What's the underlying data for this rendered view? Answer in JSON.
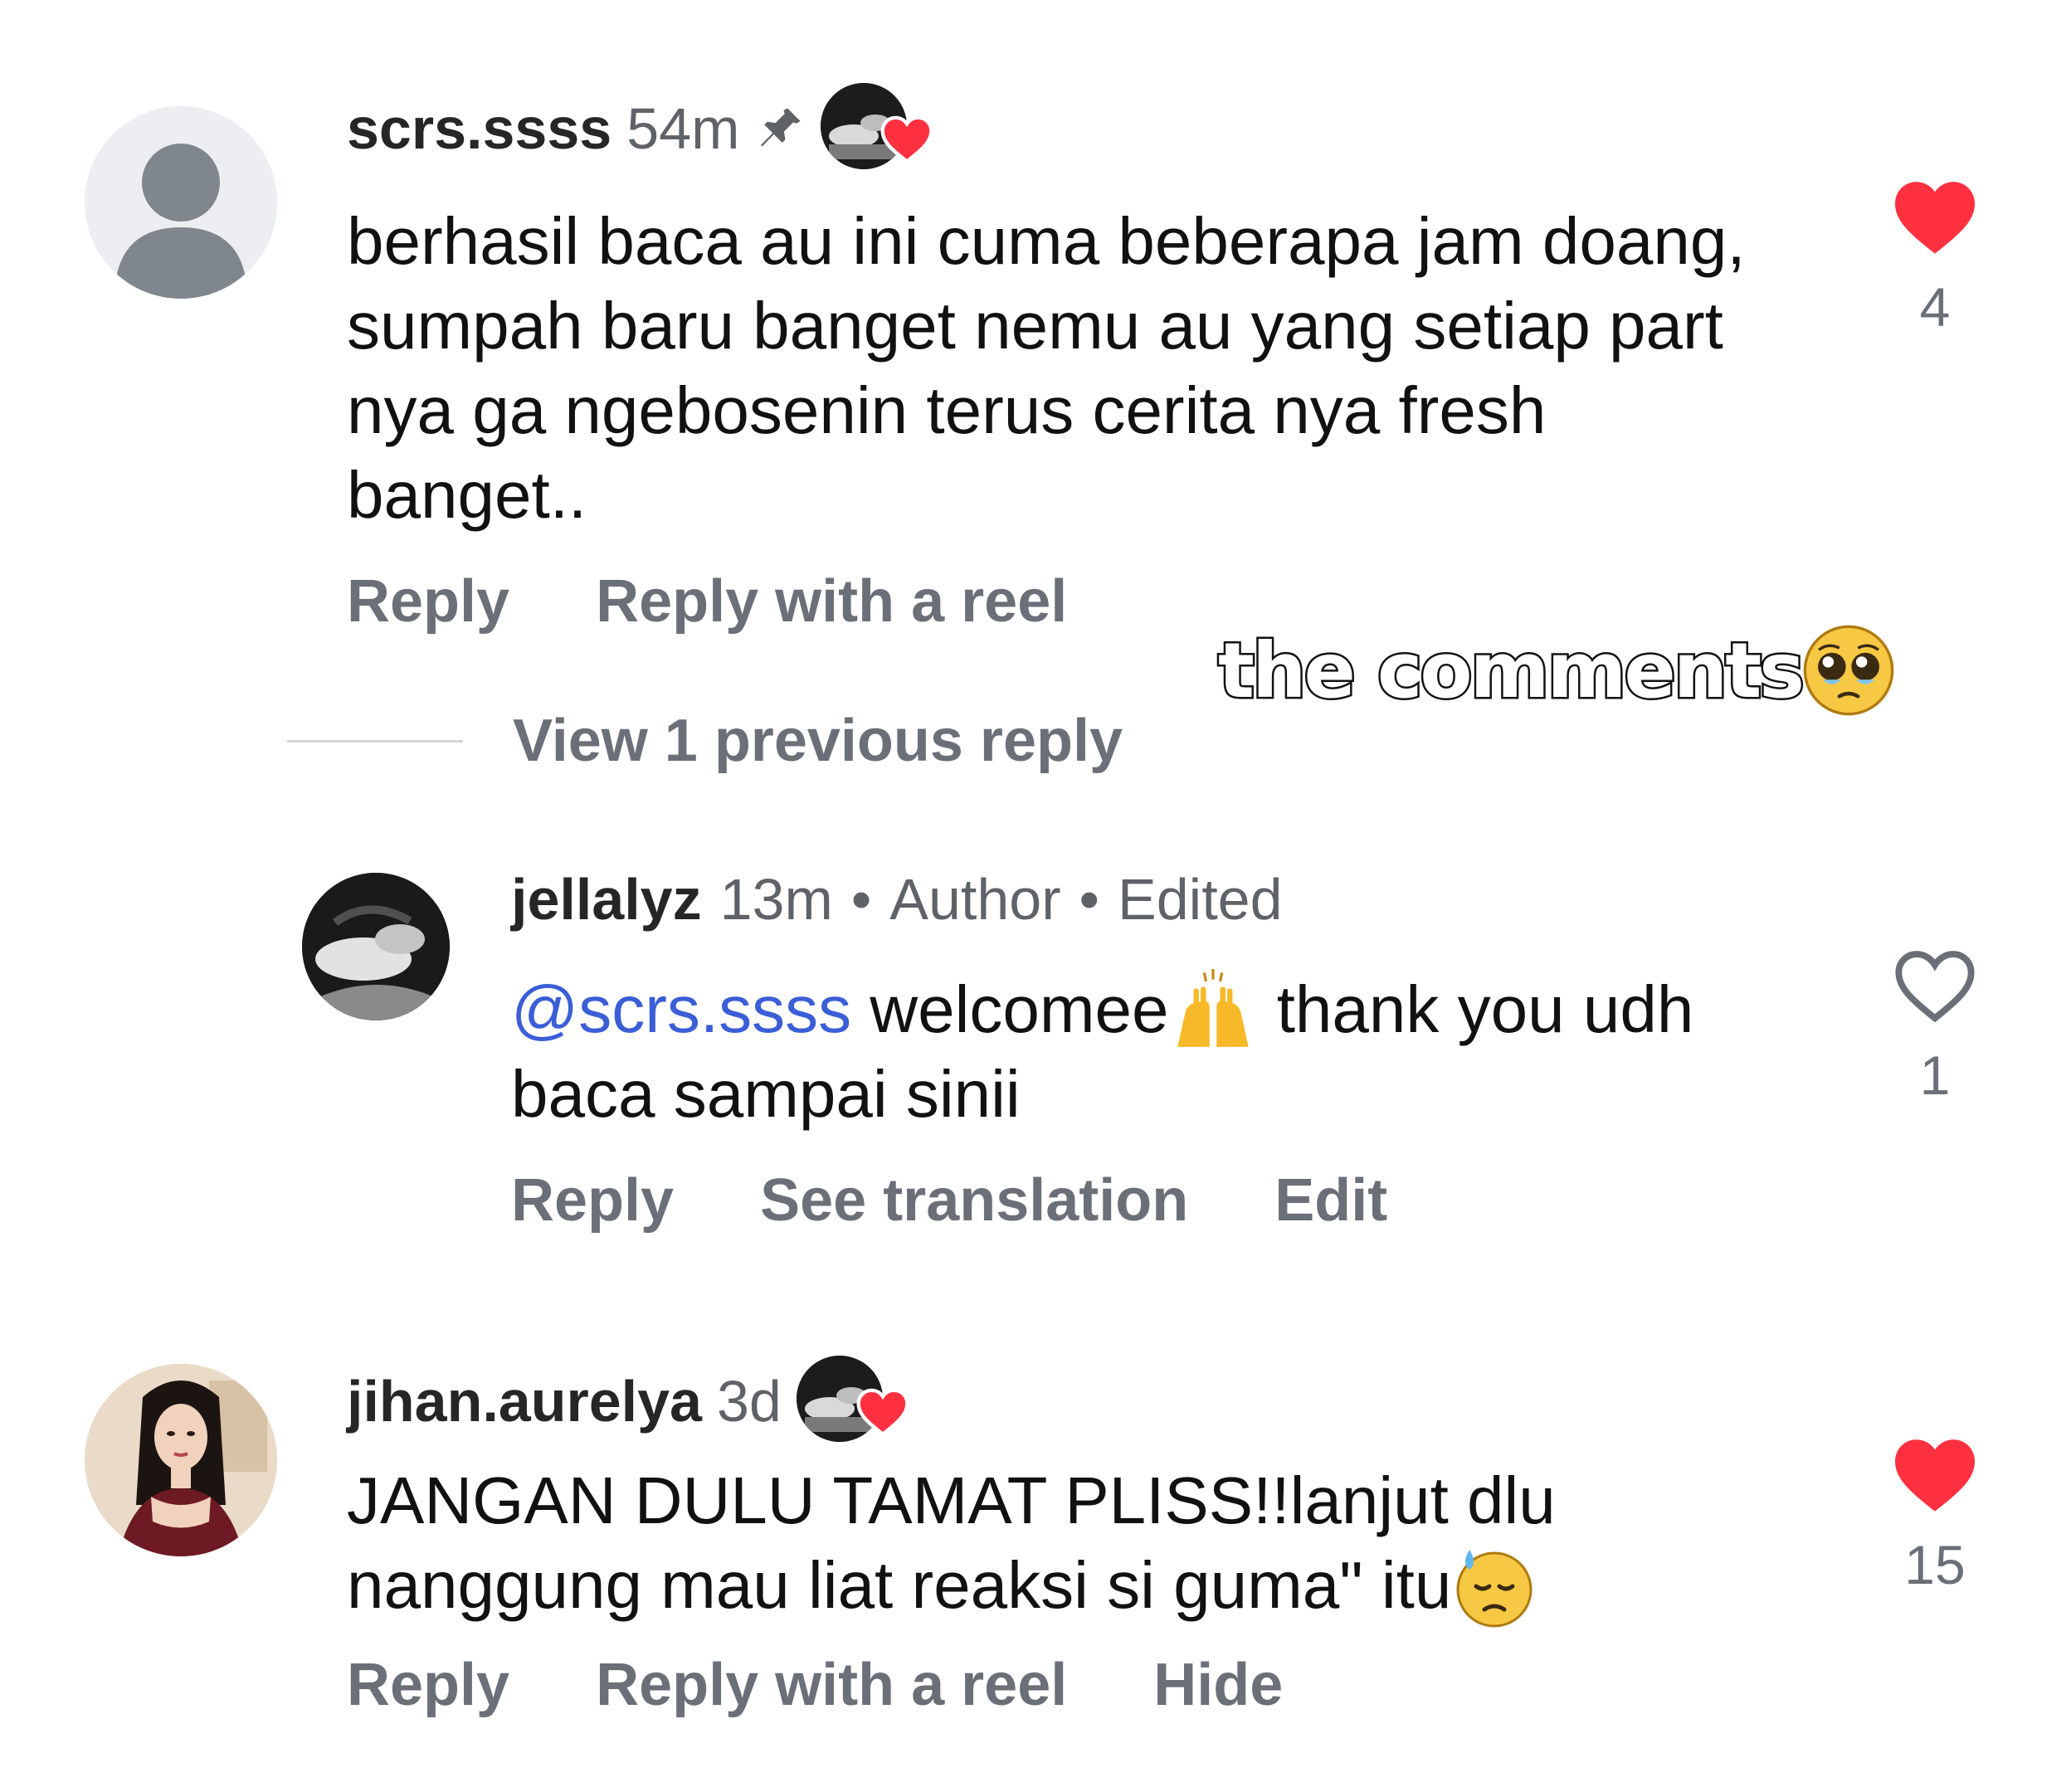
{
  "comments": [
    {
      "username": "scrs.ssss",
      "time": "54m",
      "pinned": true,
      "author_liked": true,
      "text": "berhasil baca au ini cuma beberapa jam doang, sumpah baru banget nemu au yang setiap part nya ga ngebosenin terus cerita nya fresh banget..",
      "actions": [
        "Reply",
        "Reply with a reel"
      ],
      "liked": true,
      "like_count": "4",
      "avatar": "default-avatar"
    },
    {
      "username": "jellalyz",
      "time": "13m",
      "tags": [
        "Author",
        "Edited"
      ],
      "mention": "@scrs.ssss",
      "text_after_mention": " welcomee",
      "emoji_1": "raising-hands-emoji",
      "text_after_emoji": " thank you udh baca sampai sinii",
      "actions": [
        "Reply",
        "See translation",
        "Edit"
      ],
      "liked": false,
      "like_count": "1",
      "avatar": "photo-avatar"
    },
    {
      "username": "jihan.aurelya",
      "time": "3d",
      "author_liked": true,
      "text": "JANGAN DULU TAMAT PLISS!!lanjut dlu nanggung mau liat reaksi si guma\" itu",
      "emoji_1": "downcast-sweat-emoji",
      "actions": [
        "Reply",
        "Reply with a reel",
        "Hide"
      ],
      "liked": true,
      "like_count": "15",
      "avatar": "illustrated-avatar"
    }
  ],
  "view_replies_label": "View 1 previous reply",
  "overlay_caption": "the comments",
  "overlay_emoji": "pleading-face-emoji",
  "colors": {
    "like_red": "#ff3040",
    "mention_blue": "#3b5ed7",
    "muted_gray": "#6b7078"
  }
}
